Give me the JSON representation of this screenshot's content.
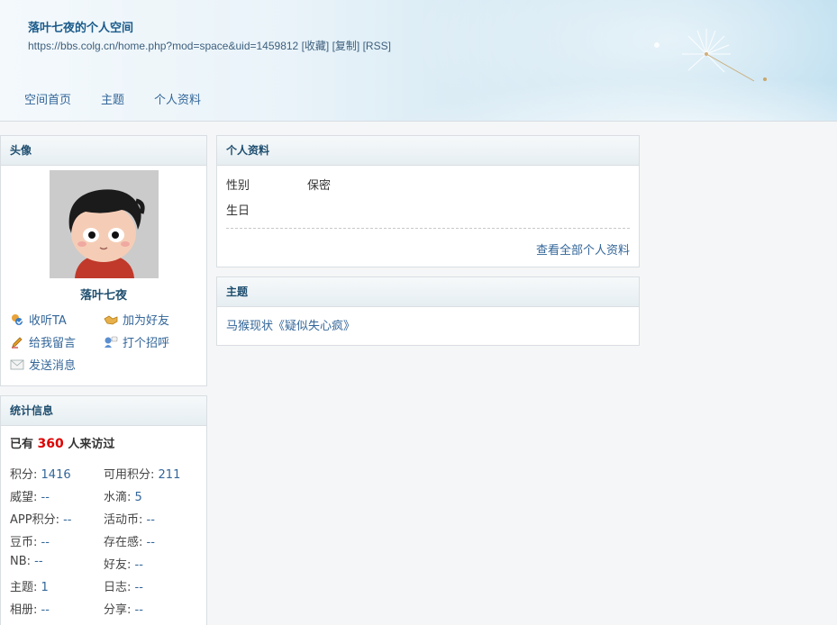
{
  "header": {
    "title": "落叶七夜的个人空间",
    "url": "https://bbs.colg.cn/home.php?mod=space&uid=1459812",
    "links": [
      "[收藏]",
      "[复制]",
      "[RSS]"
    ],
    "nav": [
      "空间首页",
      "主题",
      "个人资料"
    ]
  },
  "avatar_panel": {
    "heading": "头像",
    "username": "落叶七夜",
    "actions": [
      {
        "label": "收听TA",
        "icon": "follow-icon"
      },
      {
        "label": "加为好友",
        "icon": "handshake-icon"
      },
      {
        "label": "给我留言",
        "icon": "pencil-icon"
      },
      {
        "label": "打个招呼",
        "icon": "greet-icon"
      },
      {
        "label": "发送消息",
        "icon": "envelope-icon"
      }
    ]
  },
  "stats_panel": {
    "heading": "统计信息",
    "visits_prefix": "已有",
    "visits_count": "360",
    "visits_suffix": "人来访过",
    "items": [
      {
        "label": "积分:",
        "value": "1416"
      },
      {
        "label": "可用积分:",
        "value": "211"
      },
      {
        "label": "威望:",
        "value": "--"
      },
      {
        "label": "水滴:",
        "value": "5"
      },
      {
        "label": "APP积分:",
        "value": "--"
      },
      {
        "label": "活动币:",
        "value": "--"
      },
      {
        "label": "豆币:",
        "value": "--"
      },
      {
        "label": "存在感:",
        "value": "--"
      },
      {
        "label": "NB:",
        "value": "--"
      },
      {
        "label": "好友:",
        "value": "--"
      },
      {
        "label": "主题:",
        "value": "1"
      },
      {
        "label": "日志:",
        "value": "--"
      },
      {
        "label": "相册:",
        "value": "--"
      },
      {
        "label": "分享:",
        "value": "--"
      }
    ]
  },
  "profile_panel": {
    "heading": "个人资料",
    "gender_label": "性别",
    "gender_value": "保密",
    "birthday_label": "生日",
    "view_all": "查看全部个人资料"
  },
  "topics_panel": {
    "heading": "主题",
    "topics": [
      "马猴现状《疑似失心疯》"
    ]
  }
}
